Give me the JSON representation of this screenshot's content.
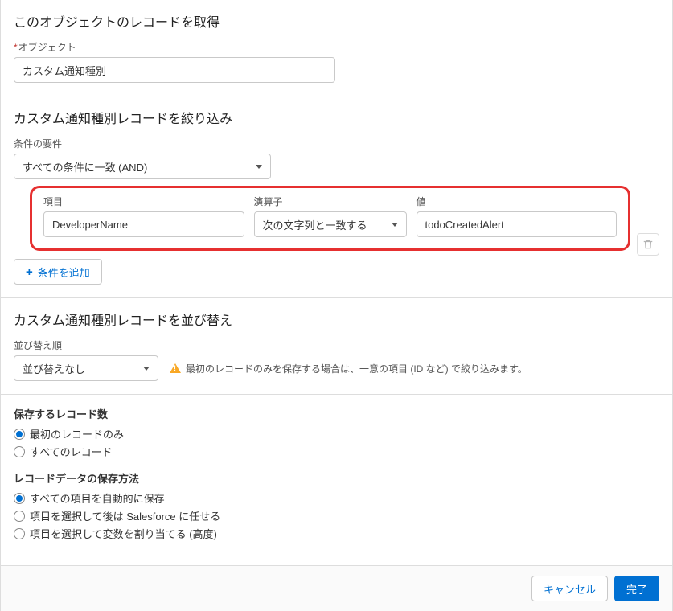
{
  "sections": {
    "get": {
      "title": "このオブジェクトのレコードを取得",
      "object_label": "オブジェクト",
      "object_value": "カスタム通知種別"
    },
    "filter": {
      "title": "カスタム通知種別レコードを絞り込み",
      "req_label": "条件の要件",
      "req_value": "すべての条件に一致 (AND)",
      "col_field": "項目",
      "col_op": "演算子",
      "col_value": "値",
      "row": {
        "field": "DeveloperName",
        "operator": "次の文字列と一致する",
        "value": "todoCreatedAlert"
      },
      "add_label": "条件を追加"
    },
    "sort": {
      "title": "カスタム通知種別レコードを並び替え",
      "label": "並び替え順",
      "value": "並び替えなし",
      "warning": "最初のレコードのみを保存する場合は、一意の項目 (ID など) で絞り込みます。"
    },
    "store": {
      "count_label": "保存するレコード数",
      "count_options": [
        "最初のレコードのみ",
        "すべてのレコード"
      ],
      "count_selected": 0,
      "method_label": "レコードデータの保存方法",
      "method_options": [
        "すべての項目を自動的に保存",
        "項目を選択して後は Salesforce に任せる",
        "項目を選択して変数を割り当てる (高度)"
      ],
      "method_selected": 0
    }
  },
  "footer": {
    "cancel": "キャンセル",
    "done": "完了"
  }
}
